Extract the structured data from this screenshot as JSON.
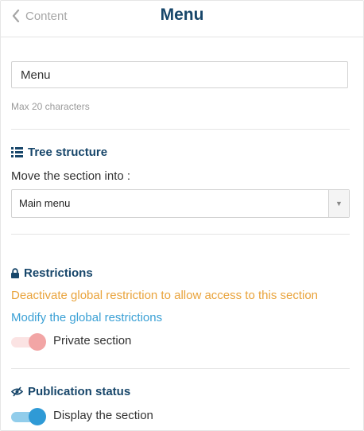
{
  "header": {
    "back_label": "Content",
    "title": "Menu"
  },
  "name_field": {
    "value": "Menu",
    "hint": "Max 20 characters"
  },
  "tree": {
    "title": "Tree structure",
    "icon": "list-icon",
    "move_label": "Move the section into :",
    "selected": "Main menu"
  },
  "restrictions": {
    "title": "Restrictions",
    "icon": "lock-icon",
    "deactivate_link": "Deactivate global restriction to allow access to this section",
    "modify_link": "Modify the global restrictions",
    "private_label": "Private section",
    "private_on": true
  },
  "publication": {
    "title": "Publication status",
    "icon": "eye-slash-icon",
    "display_label": "Display the section",
    "display_on": true
  },
  "colors": {
    "title": "#17466a",
    "link_orange": "#e9a33b",
    "link_blue": "#3aa0d5",
    "toggle_private": "#f2a5a5",
    "toggle_display": "#2f9ad6"
  }
}
